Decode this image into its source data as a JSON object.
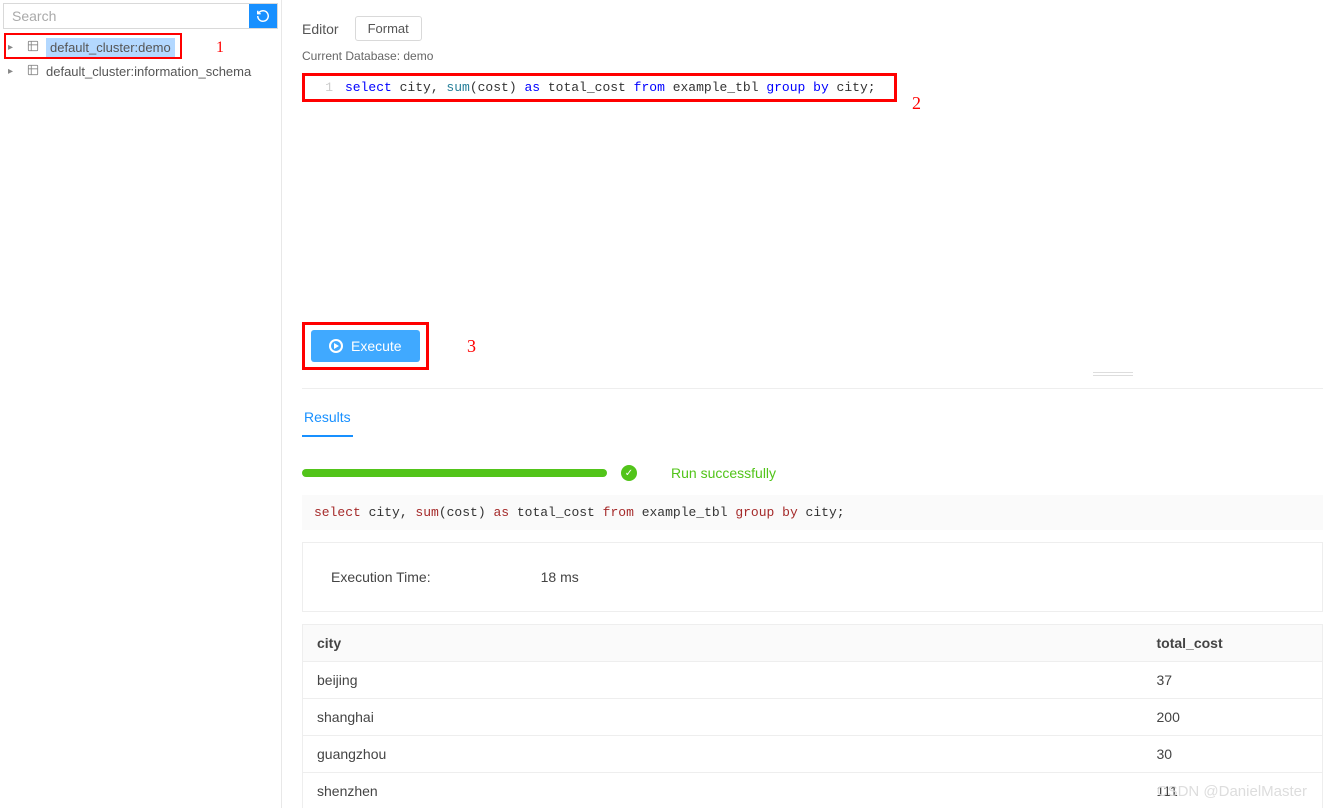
{
  "sidebar": {
    "search_placeholder": "Search",
    "items": [
      {
        "label": "default_cluster:demo",
        "selected": true
      },
      {
        "label": "default_cluster:information_schema",
        "selected": false
      }
    ]
  },
  "annotations": {
    "a1": "1",
    "a2": "2",
    "a3": "3"
  },
  "toolbar": {
    "editor_label": "Editor",
    "format_label": "Format"
  },
  "status": {
    "current_db_label": "Current Database: demo"
  },
  "editor": {
    "line_no": "1",
    "tokens": {
      "select": "select",
      "city1": " city, ",
      "sum": "sum",
      "paren": "(cost) ",
      "as": "as",
      "alias": " total_cost ",
      "from": "from",
      "tbl": " example_tbl ",
      "group": "group",
      "sp": " ",
      "by": "by",
      "city2": " city;"
    }
  },
  "execute": {
    "label": "Execute"
  },
  "tabs": {
    "results": "Results"
  },
  "run": {
    "success_text": "Run successfully",
    "echo": {
      "select": "select",
      "p1": " city, ",
      "sum": "sum",
      "p2": "(cost) ",
      "as": "as",
      "p3": " total_cost ",
      "from": "from",
      "p4": " example_tbl ",
      "group": "group",
      "sp": " ",
      "by": "by",
      "p5": " city;"
    },
    "exec_time_label": "Execution Time:",
    "exec_time_value": "18 ms"
  },
  "table": {
    "headers": {
      "c1": "city",
      "c2": "total_cost"
    },
    "rows": [
      {
        "c1": "beijing",
        "c2": "37"
      },
      {
        "c1": "shanghai",
        "c2": "200"
      },
      {
        "c1": "guangzhou",
        "c2": "30"
      },
      {
        "c1": "shenzhen",
        "c2": "111"
      }
    ]
  },
  "watermark": "CSDN @DanielMaster"
}
